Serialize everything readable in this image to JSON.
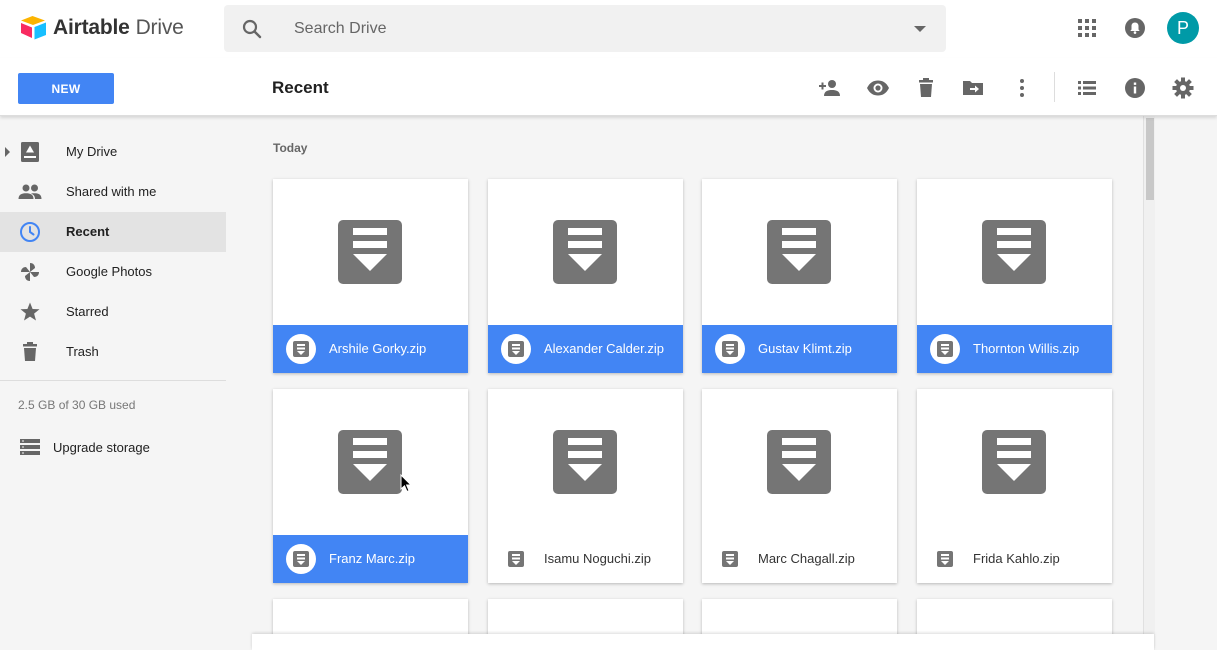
{
  "app": {
    "brand": "Airtable",
    "product": "Drive"
  },
  "search": {
    "placeholder": "Search Drive",
    "value": ""
  },
  "user": {
    "avatar_initial": "P",
    "avatar_color": "#009aa7"
  },
  "toolbar": {
    "new_label": "NEW",
    "title": "Recent",
    "actions": [
      "add-person-icon",
      "preview-eye-icon",
      "delete-icon",
      "move-to-folder-icon",
      "more-vert-icon",
      "list-view-icon",
      "info-icon",
      "settings-gear-icon"
    ]
  },
  "sidebar": {
    "items": [
      {
        "label": "My Drive",
        "icon": "my-drive-icon",
        "active": false
      },
      {
        "label": "Shared with me",
        "icon": "people-icon",
        "active": false
      },
      {
        "label": "Recent",
        "icon": "clock-icon",
        "active": true
      },
      {
        "label": "Google Photos",
        "icon": "pinwheel-icon",
        "active": false
      },
      {
        "label": "Starred",
        "icon": "star-icon",
        "active": false
      },
      {
        "label": "Trash",
        "icon": "trash-icon",
        "active": false
      }
    ],
    "storage_text": "2.5 GB of 30 GB used",
    "upgrade_label": "Upgrade storage"
  },
  "main": {
    "section_label": "Today",
    "files": [
      {
        "name": "Arshile Gorky.zip",
        "selected": true
      },
      {
        "name": "Alexander Calder.zip",
        "selected": true
      },
      {
        "name": "Gustav Klimt.zip",
        "selected": true
      },
      {
        "name": "Thornton Willis.zip",
        "selected": true
      },
      {
        "name": "Franz Marc.zip",
        "selected": true
      },
      {
        "name": "Isamu Noguchi.zip",
        "selected": false
      },
      {
        "name": "Marc Chagall.zip",
        "selected": false
      },
      {
        "name": "Frida Kahlo.zip",
        "selected": false
      }
    ]
  },
  "colors": {
    "accent": "#4285f4",
    "icon_gray": "#757575",
    "sidebar_active": "#e3e3e3"
  }
}
